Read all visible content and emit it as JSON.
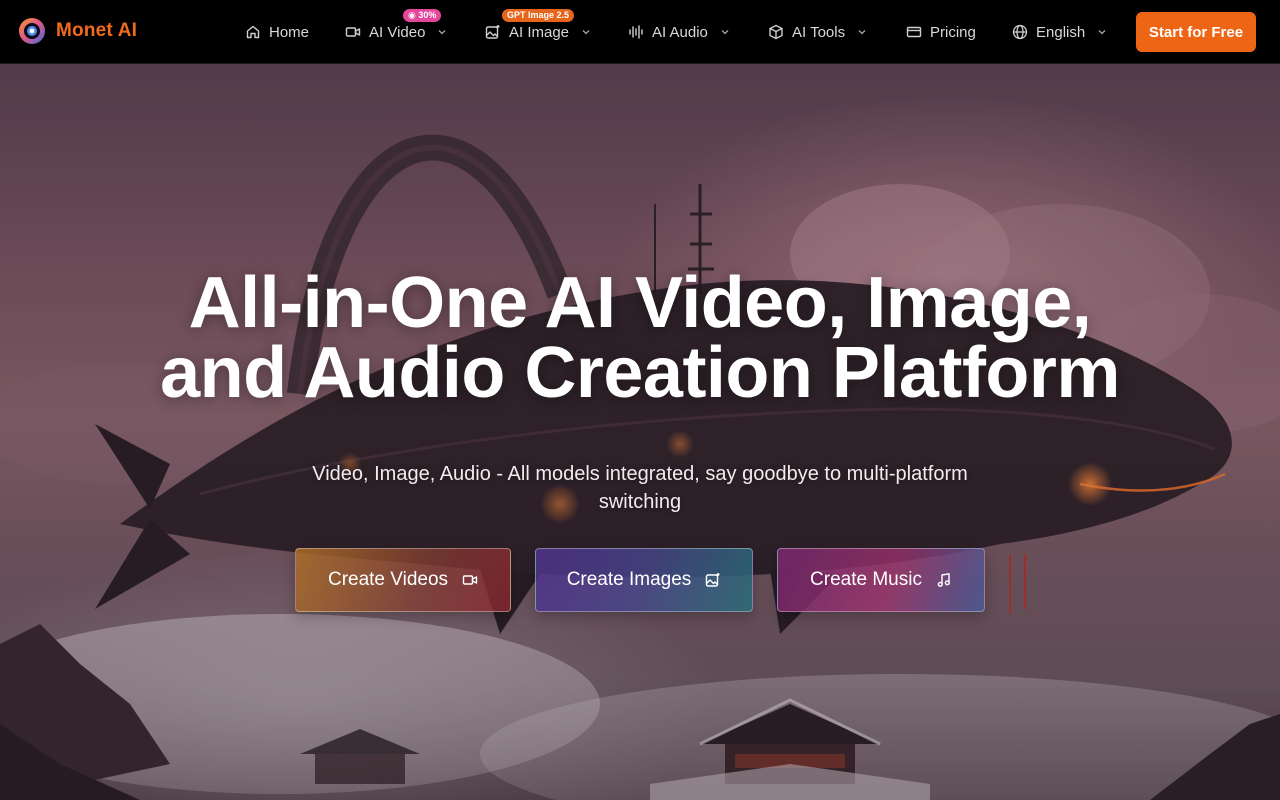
{
  "brand": {
    "name": "Monet AI"
  },
  "nav": {
    "home": "Home",
    "ai_video": "AI Video",
    "ai_video_badge": "30%",
    "ai_image": "AI Image",
    "ai_image_badge": "GPT Image 2.5",
    "ai_audio": "AI Audio",
    "ai_tools": "AI Tools",
    "pricing": "Pricing",
    "language": "English",
    "cta": "Start for Free"
  },
  "hero": {
    "headline_line1": "All-in-One AI Video, Image,",
    "headline_line2": "and Audio Creation Platform",
    "subtitle": "Video, Image, Audio - All models integrated, say goodbye to multi-platform switching",
    "buttons": {
      "videos": "Create Videos",
      "images": "Create Images",
      "music": "Create Music"
    }
  },
  "colors": {
    "brand": "#f26b1d",
    "cta_bg": "#ee6515",
    "badge_pink": "#e4469a",
    "badge_orange": "#e6651d"
  },
  "icons": {
    "home": "home-icon",
    "video": "video-camera-icon",
    "image": "image-sparkle-icon",
    "audio": "audio-wave-icon",
    "tools": "cube-icon",
    "pricing": "card-icon",
    "language": "globe-icon",
    "music": "music-note-icon"
  }
}
